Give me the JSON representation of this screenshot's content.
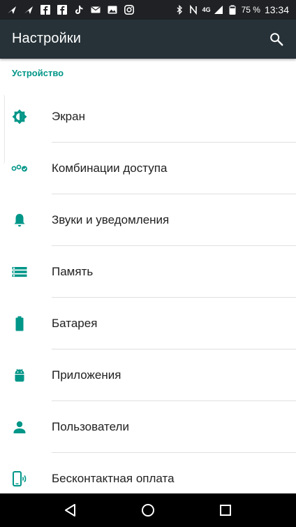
{
  "status_bar": {
    "time": "13:34",
    "battery_percent": "75 %",
    "network": "4G",
    "left_icons": [
      "send-icon",
      "send-icon",
      "facebook-icon",
      "facebook-icon",
      "tiktok-icon",
      "mail-icon",
      "image-icon",
      "instagram-icon"
    ],
    "right_icons": [
      "bluetooth-icon",
      "nfc-icon",
      "signal-icon",
      "battery-icon"
    ]
  },
  "toolbar": {
    "title": "Настройки",
    "search_icon": "search-icon"
  },
  "section": {
    "header": "Устройство"
  },
  "items": [
    {
      "label": "Экран",
      "icon": "brightness-icon"
    },
    {
      "label": "Комбинации доступа",
      "icon": "gesture-icon"
    },
    {
      "label": "Звуки и уведомления",
      "icon": "bell-icon"
    },
    {
      "label": "Память",
      "icon": "storage-icon"
    },
    {
      "label": "Батарея",
      "icon": "battery-icon"
    },
    {
      "label": "Приложения",
      "icon": "android-icon"
    },
    {
      "label": "Пользователи",
      "icon": "person-icon"
    },
    {
      "label": "Бесконтактная оплата",
      "icon": "tap-pay-icon"
    }
  ],
  "colors": {
    "accent": "#009688",
    "toolbar": "#263238",
    "status_bar": "#1f2124",
    "text": "#212121",
    "divider": "#e0e0e0"
  },
  "nav_bar": {
    "buttons": [
      "back-icon",
      "home-icon",
      "recents-icon"
    ]
  }
}
